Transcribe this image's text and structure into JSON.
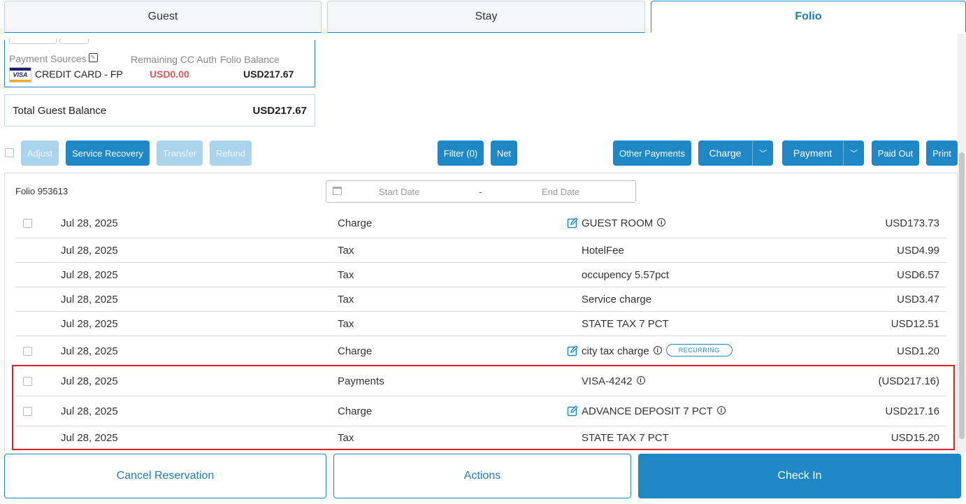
{
  "tabs": [
    {
      "label": "Guest",
      "active": false
    },
    {
      "label": "Stay",
      "active": false
    },
    {
      "label": "Folio",
      "active": true
    }
  ],
  "payment_card": {
    "sources_label": "Payment Sources",
    "card_brand": "VISA",
    "card_name": "CREDIT CARD - FP",
    "remaining_label": "Remaining CC Auth",
    "remaining_value": "USD0.00",
    "folio_balance_label": "Folio Balance",
    "folio_balance_value": "USD217.67"
  },
  "total_guest_balance": {
    "label": "Total Guest Balance",
    "value": "USD217.67"
  },
  "toolbar": {
    "adjust": "Adjust",
    "service_recovery": "Service Recovery",
    "transfer": "Transfer",
    "refund": "Refund",
    "filter": "Filter (0)",
    "net": "Net",
    "other_payments": "Other Payments",
    "charge": "Charge",
    "payment": "Payment",
    "paid_out": "Paid Out",
    "print": "Print"
  },
  "folio": {
    "title": "Folio 953613",
    "start_placeholder": "Start Date",
    "range_separator": "-",
    "end_placeholder": "End Date",
    "rows": [
      {
        "date": "Jul 28, 2025",
        "type": "Charge",
        "description": "GUEST ROOM",
        "amount": "USD173.73",
        "checkbox": true,
        "editable": true,
        "info": true
      },
      {
        "date": "Jul 28, 2025",
        "type": "Tax",
        "description": "HotelFee",
        "amount": "USD4.99",
        "checkbox": false,
        "editable": false,
        "info": false
      },
      {
        "date": "Jul 28, 2025",
        "type": "Tax",
        "description": "occupency 5.57pct",
        "amount": "USD6.57",
        "checkbox": false,
        "editable": false,
        "info": false
      },
      {
        "date": "Jul 28, 2025",
        "type": "Tax",
        "description": "Service charge",
        "amount": "USD3.47",
        "checkbox": false,
        "editable": false,
        "info": false
      },
      {
        "date": "Jul 28, 2025",
        "type": "Tax",
        "description": "STATE TAX 7 PCT",
        "amount": "USD12.51",
        "checkbox": false,
        "editable": false,
        "info": false
      },
      {
        "date": "Jul 28, 2025",
        "type": "Charge",
        "description": "city tax charge",
        "amount": "USD1.20",
        "checkbox": true,
        "editable": true,
        "info": true,
        "badge": "RECURRING"
      },
      {
        "date": "Jul 28, 2025",
        "type": "Payments",
        "description": "VISA-4242",
        "amount": "(USD217.16)",
        "checkbox": true,
        "editable": false,
        "info": true
      },
      {
        "date": "Jul 28, 2025",
        "type": "Charge",
        "description": "ADVANCE DEPOSIT 7 PCT",
        "amount": "USD217.16",
        "checkbox": true,
        "editable": true,
        "info": true
      },
      {
        "date": "Jul 28, 2025",
        "type": "Tax",
        "description": "STATE TAX 7 PCT",
        "amount": "USD15.20",
        "checkbox": false,
        "editable": false,
        "info": false
      }
    ]
  },
  "footer": {
    "cancel": "Cancel Reservation",
    "actions": "Actions",
    "check_in": "Check In"
  },
  "icons": {
    "info": "info-icon",
    "edit": "edit-icon",
    "calendar": "calendar-icon",
    "dropdown": "chevron-down-icon"
  },
  "colors": {
    "primary": "#1e88c7",
    "disabled": "#a9d4ec",
    "negative": "#e05555",
    "highlight": "#e01e1e"
  }
}
